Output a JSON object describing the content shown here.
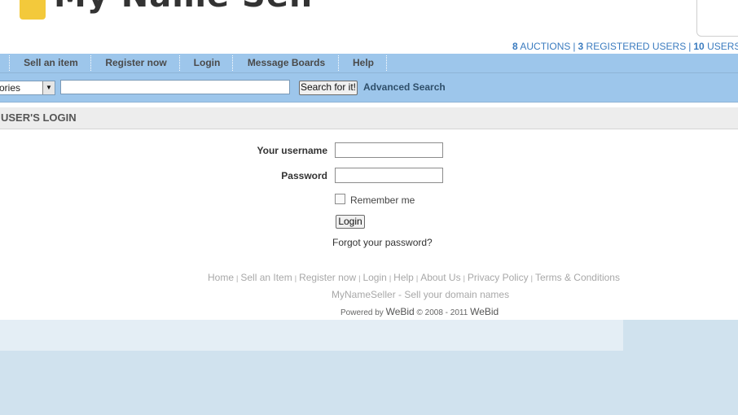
{
  "header": {
    "logo_text": "My Name Seller",
    "stats": {
      "auctions_count": "8",
      "auctions_label": "AUCTIONS",
      "users_count": "3",
      "users_label": "REGISTERED USERS",
      "online_count": "10",
      "online_label": "USERS"
    }
  },
  "nav": {
    "items": [
      {
        "label": "Sell an item"
      },
      {
        "label": "Register now"
      },
      {
        "label": "Login"
      },
      {
        "label": "Message Boards"
      },
      {
        "label": "Help"
      }
    ]
  },
  "search": {
    "category_value": "ories",
    "input_value": "",
    "button_label": "Search for it!",
    "advanced_label": "Advanced Search"
  },
  "login": {
    "heading": "USER'S LOGIN",
    "username_label": "Your username",
    "password_label": "Password",
    "remember_label": "Remember me",
    "login_button": "Login",
    "forgot_link": "Forgot your password?"
  },
  "footer": {
    "links": [
      "Home",
      "Sell an Item",
      "Register now",
      "Login",
      "Help",
      "About Us",
      "Privacy Policy",
      "Terms & Conditions"
    ],
    "tagline": "MyNameSeller - Sell your domain names",
    "powered_prefix": "Powered by",
    "powered_brand": "WeBid",
    "powered_copy": "© 2008 - 2011",
    "powered_brand2": "WeBid"
  },
  "colors": {
    "nav_bg": "#9dc6eb",
    "link_blue": "#3a7bbf",
    "logo_mark": "#f3c93b",
    "bottom_bg": "#d0e2ee"
  }
}
